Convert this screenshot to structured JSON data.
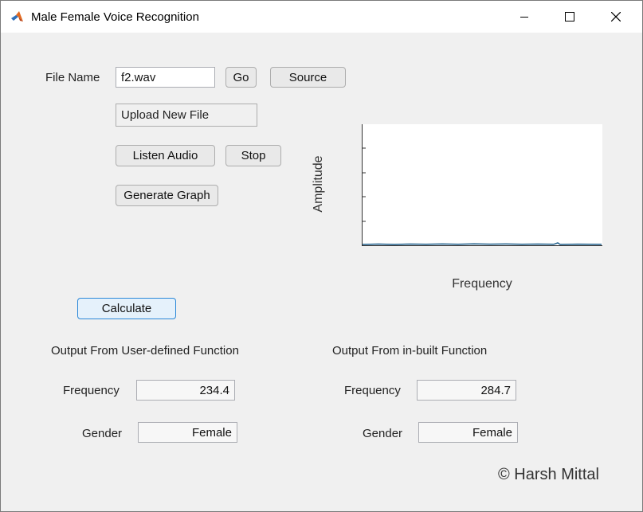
{
  "window": {
    "title": "Male Female Voice Recognition",
    "controls": [
      "minimize-icon",
      "maximize-icon",
      "close-icon"
    ]
  },
  "file": {
    "label": "File Name",
    "value": "f2.wav",
    "go_label": "Go",
    "source_label": "Source",
    "upload_label": "Upload New File"
  },
  "audio": {
    "listen_label": "Listen Audio",
    "stop_label": "Stop",
    "generate_label": "Generate Graph"
  },
  "graph": {
    "ylabel": "Amplitude",
    "xlabel": "Frequency"
  },
  "calculate_label": "Calculate",
  "user_defined": {
    "heading": "Output From User-defined Function",
    "frequency_label": "Frequency",
    "frequency_value": "234.4",
    "gender_label": "Gender",
    "gender_value": "Female"
  },
  "inbuilt": {
    "heading": "Output From in-built Function",
    "frequency_label": "Frequency",
    "frequency_value": "284.7",
    "gender_label": "Gender",
    "gender_value": "Female"
  },
  "copyright": "© Harsh Mittal",
  "colors": {
    "background": "#f0f0f0",
    "primary_border": "#2b88d8",
    "signal": "#1f5f8b"
  }
}
